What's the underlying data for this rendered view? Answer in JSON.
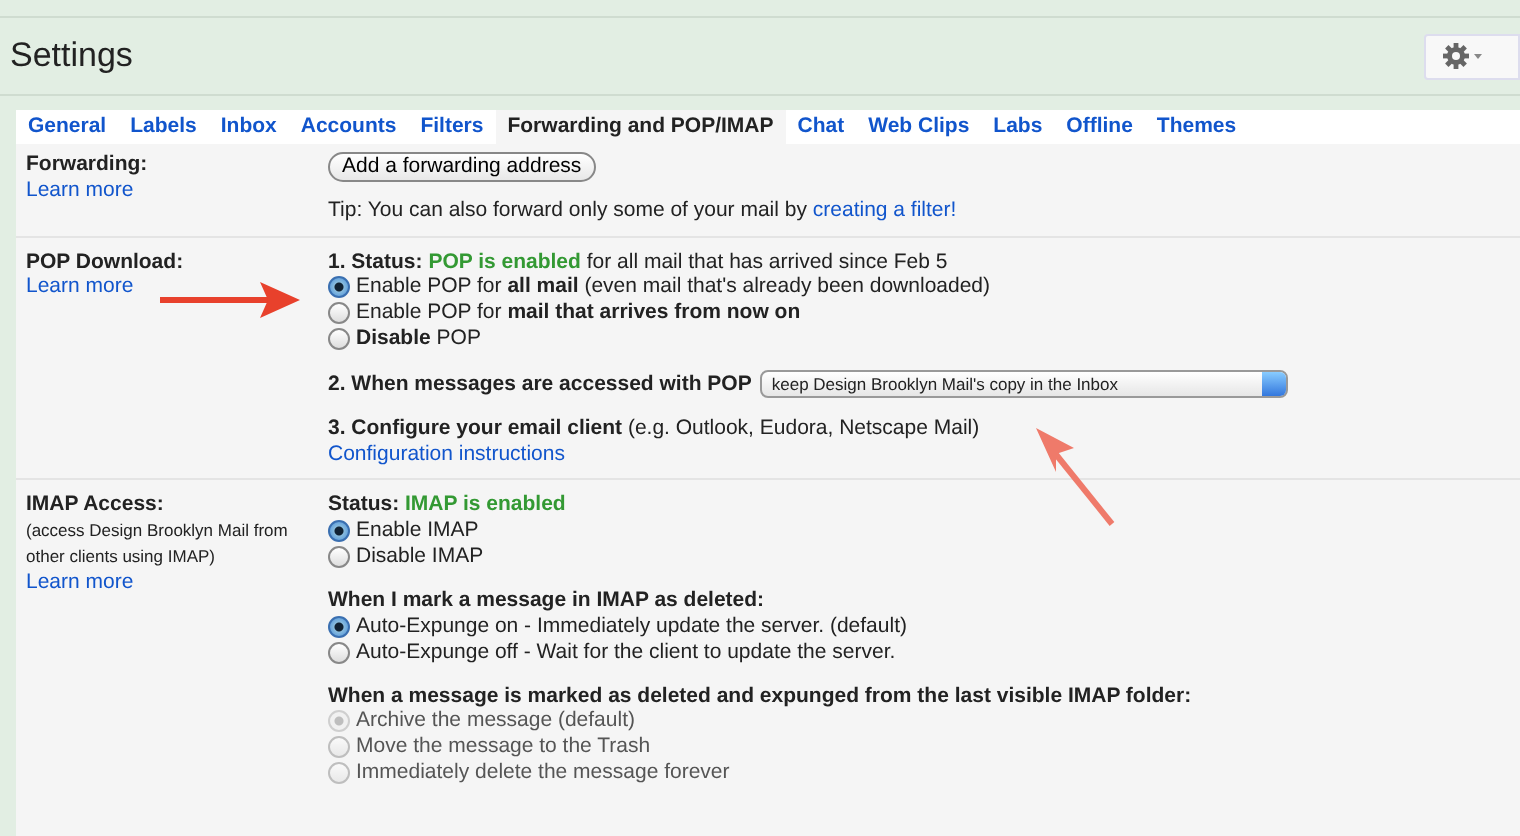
{
  "header": {
    "title": "Settings"
  },
  "tabs": [
    {
      "label": "General",
      "selected": false
    },
    {
      "label": "Labels",
      "selected": false
    },
    {
      "label": "Inbox",
      "selected": false
    },
    {
      "label": "Accounts",
      "selected": false
    },
    {
      "label": "Filters",
      "selected": false
    },
    {
      "label": "Forwarding and POP/IMAP",
      "selected": true
    },
    {
      "label": "Chat",
      "selected": false
    },
    {
      "label": "Web Clips",
      "selected": false
    },
    {
      "label": "Labs",
      "selected": false
    },
    {
      "label": "Offline",
      "selected": false
    },
    {
      "label": "Themes",
      "selected": false
    }
  ],
  "forwarding": {
    "label": "Forwarding:",
    "learn_more": "Learn more",
    "button": "Add a forwarding address",
    "tip": "Tip: You can also forward only some of your mail by ",
    "tip_link": "creating a filter!"
  },
  "pop_download": {
    "label": "POP Download:",
    "learn_more": "Learn more",
    "status": {
      "label": "1. Status:",
      "value": "POP is enabled",
      "detail": "for all mail that has arrived since Feb 5"
    },
    "options": [
      {
        "text": "Enable POP for **all mail** (even mail that's already been downloaded)",
        "selected": true,
        "disabled": false
      },
      {
        "text": "Enable POP for **mail that arrives from now on**",
        "selected": false,
        "disabled": false
      },
      {
        "text": "**Disable** POP",
        "selected": false,
        "disabled": false
      }
    ],
    "access": {
      "label": "2. When messages are accessed with POP",
      "value": "keep Design Brooklyn Mail's copy in the Inbox"
    },
    "configure": {
      "text": "**3. Configure your email client** (e.g. Outlook, Eudora, Netscape Mail)",
      "link": "Configuration instructions"
    }
  },
  "imap_access": {
    "label": "IMAP Access:",
    "note": "(access Design Brooklyn Mail from other clients using IMAP)",
    "learn_more": "Learn more",
    "status": {
      "label": "Status:",
      "value": "IMAP is enabled"
    },
    "options": [
      {
        "text": "Enable IMAP",
        "selected": true,
        "disabled": false
      },
      {
        "text": "Disable IMAP",
        "selected": false,
        "disabled": false
      }
    ],
    "groups": [
      {
        "heading": "When I mark a message in IMAP as deleted:",
        "options": [
          {
            "text": "Auto-Expunge on - Immediately update the server. (default)",
            "selected": true,
            "disabled": false
          },
          {
            "text": "Auto-Expunge off - Wait for the client to update the server.",
            "selected": false,
            "disabled": false
          }
        ]
      },
      {
        "heading": "When a message is marked as deleted and expunged from the last visible IMAP folder:",
        "options": [
          {
            "text": "Archive the message (default)",
            "selected": true,
            "disabled": true
          },
          {
            "text": "Move the message to the Trash",
            "selected": false,
            "disabled": true
          },
          {
            "text": "Immediately delete the message forever",
            "selected": false,
            "disabled": true
          }
        ]
      }
    ]
  }
}
